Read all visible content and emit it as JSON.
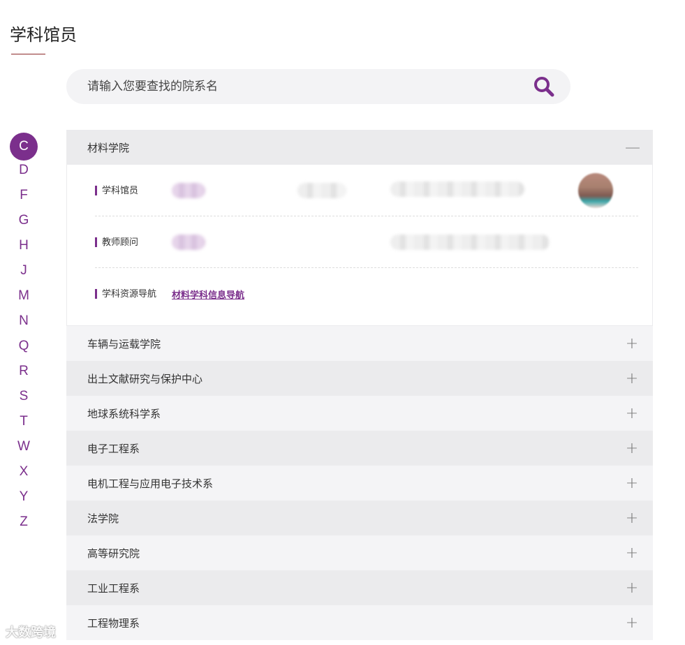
{
  "page_title": "学科馆员",
  "search": {
    "placeholder": "请输入您要查找的院系名",
    "icon": "search-icon"
  },
  "colors": {
    "accent": "#7b2f8c",
    "title_underline": "#8b2a2a",
    "row_dark": "#ebebed",
    "row_light": "#f4f4f6"
  },
  "alphabet": [
    {
      "letter": "C",
      "active": true
    },
    {
      "letter": "D",
      "active": false
    },
    {
      "letter": "F",
      "active": false
    },
    {
      "letter": "G",
      "active": false
    },
    {
      "letter": "H",
      "active": false
    },
    {
      "letter": "J",
      "active": false
    },
    {
      "letter": "M",
      "active": false
    },
    {
      "letter": "N",
      "active": false
    },
    {
      "letter": "Q",
      "active": false
    },
    {
      "letter": "R",
      "active": false
    },
    {
      "letter": "S",
      "active": false
    },
    {
      "letter": "T",
      "active": false
    },
    {
      "letter": "W",
      "active": false
    },
    {
      "letter": "X",
      "active": false
    },
    {
      "letter": "Y",
      "active": false
    },
    {
      "letter": "Z",
      "active": false
    }
  ],
  "expanded": {
    "name": "材料学院",
    "toggle": "—",
    "rows": {
      "librarian_label": "学科馆员",
      "advisor_label": "教师顾问",
      "resource_label": "学科资源导航",
      "resource_link": "材料学科信息导航"
    }
  },
  "departments": [
    {
      "name": "车辆与运载学院",
      "toggle": "+"
    },
    {
      "name": "出土文献研究与保护中心",
      "toggle": "+"
    },
    {
      "name": "地球系统科学系",
      "toggle": "+"
    },
    {
      "name": "电子工程系",
      "toggle": "+"
    },
    {
      "name": "电机工程与应用电子技术系",
      "toggle": "+"
    },
    {
      "name": "法学院",
      "toggle": "+"
    },
    {
      "name": "高等研究院",
      "toggle": "+"
    },
    {
      "name": "工业工程系",
      "toggle": "+"
    },
    {
      "name": "工程物理系",
      "toggle": "+"
    }
  ],
  "watermark": "大数跨境"
}
